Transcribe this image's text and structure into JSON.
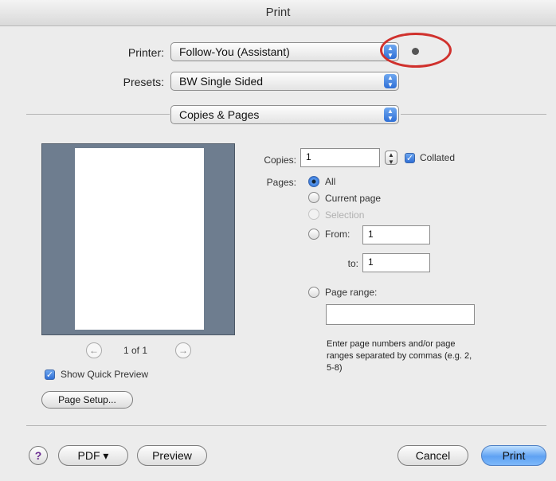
{
  "window": {
    "title": "Print"
  },
  "printer": {
    "label": "Printer:",
    "value": "Follow-You (Assistant)"
  },
  "presets": {
    "label": "Presets:",
    "value": "BW Single Sided"
  },
  "panel": {
    "value": "Copies & Pages"
  },
  "preview": {
    "page_indicator": "1 of 1",
    "show_quick_preview": "Show Quick Preview",
    "show_quick_preview_checked": true,
    "page_setup_label": "Page Setup..."
  },
  "copies": {
    "label": "Copies:",
    "value": "1",
    "collated_label": "Collated",
    "collated_checked": true
  },
  "pages": {
    "label": "Pages:",
    "options": [
      "All",
      "Current page",
      "Selection",
      "From:",
      "Page range:"
    ],
    "selected": "All",
    "from_value": "1",
    "to_label": "to:",
    "to_value": "1",
    "range_value": "",
    "hint": "Enter page numbers and/or page ranges separated by commas (e.g. 2, 5-8)"
  },
  "footer": {
    "help": "?",
    "pdf_label": "PDF ▾",
    "preview_label": "Preview",
    "cancel_label": "Cancel",
    "print_label": "Print"
  },
  "colors": {
    "annotation": "#d0312d",
    "accent": "#2f6fd6"
  }
}
